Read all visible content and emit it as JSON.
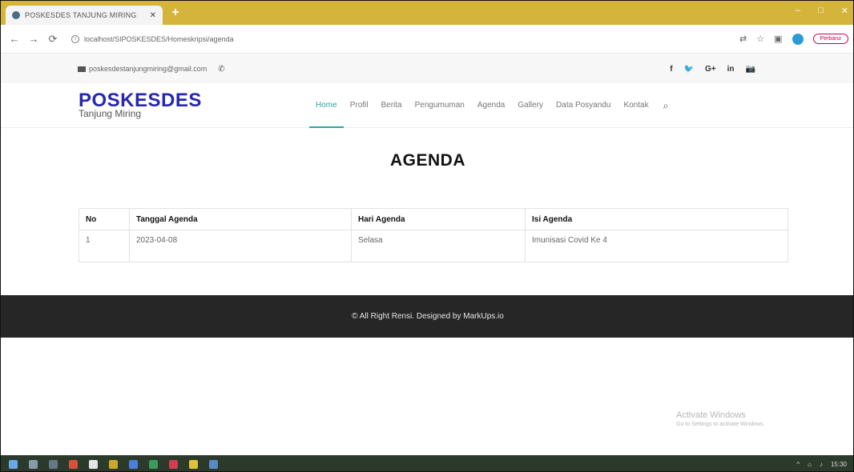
{
  "browser": {
    "tab_title": "POSKESDES TANJUNG MIRING",
    "tab_close": "✕",
    "new_tab": "+",
    "window_controls": [
      "–",
      "□",
      "✕"
    ],
    "url": "localhost/SIPOSKESDES/Homeskripsi/agenda",
    "profile_label": "Perbarui"
  },
  "topbar": {
    "email": "poskesdestanjungmiring@gmail.com",
    "social": [
      "f",
      "🐦",
      "G+",
      "in",
      "📷"
    ]
  },
  "header": {
    "logo_title": "POSKESDES",
    "logo_subtitle": "Tanjung Miring",
    "nav": [
      "Home",
      "Profil",
      "Berita",
      "Pengumuman",
      "Agenda",
      "Gallery",
      "Data Posyandu",
      "Kontak"
    ],
    "active_nav": "Home"
  },
  "main": {
    "title": "AGENDA",
    "table": {
      "headers": [
        "No",
        "Tanggal Agenda",
        "Hari Agenda",
        "Isi Agenda"
      ],
      "rows": [
        [
          "1",
          "2023-04-08",
          "Selasa",
          "Imunisasi Covid Ke 4"
        ]
      ]
    }
  },
  "footer": {
    "text": "© All Right Rensi. Designed by MarkUps.io"
  },
  "watermark": {
    "title": "Activate Windows",
    "subtitle": "Go to Settings to activate Windows."
  },
  "taskbar": {
    "time": "15:30"
  },
  "colors": {
    "brand": "#2727b0",
    "accent": "#2ba7a0",
    "footer_bg": "#262626",
    "browser_frame": "#d4b43a"
  }
}
